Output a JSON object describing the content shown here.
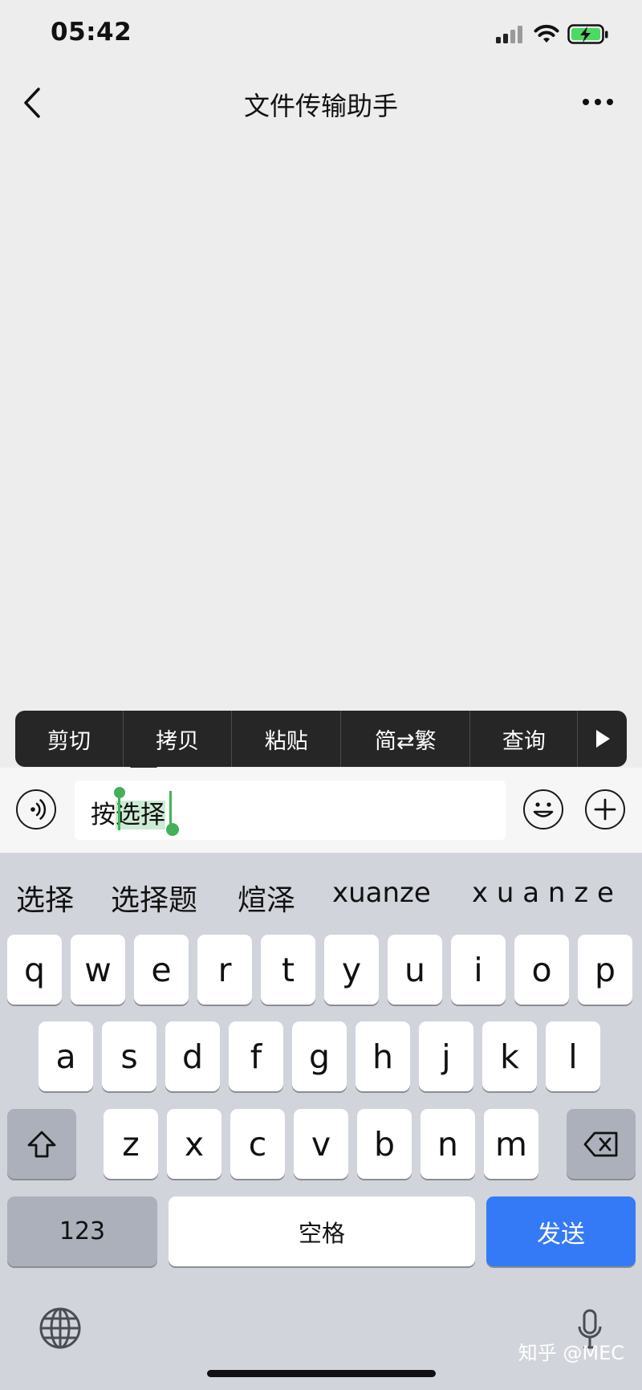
{
  "status_bar": {
    "time": "05:42"
  },
  "nav": {
    "title": "文件传输助手"
  },
  "context_menu": {
    "items": [
      "剪切",
      "拷贝",
      "粘贴",
      "简⇄繁",
      "查询"
    ]
  },
  "input": {
    "text_before": "按",
    "text_selected": "选择"
  },
  "keyboard": {
    "candidates": [
      "选择",
      "选择题",
      "煊泽",
      "xuanze",
      "x u a n z e"
    ],
    "row1": [
      "q",
      "w",
      "e",
      "r",
      "t",
      "y",
      "u",
      "i",
      "o",
      "p"
    ],
    "row2": [
      "a",
      "s",
      "d",
      "f",
      "g",
      "h",
      "j",
      "k",
      "l"
    ],
    "row3": [
      "z",
      "x",
      "c",
      "v",
      "b",
      "n",
      "m"
    ],
    "num_key": "123",
    "space_key": "空格",
    "send_key": "发送",
    "send_color": "#3479f6"
  },
  "watermark": "知乎 @MEC"
}
